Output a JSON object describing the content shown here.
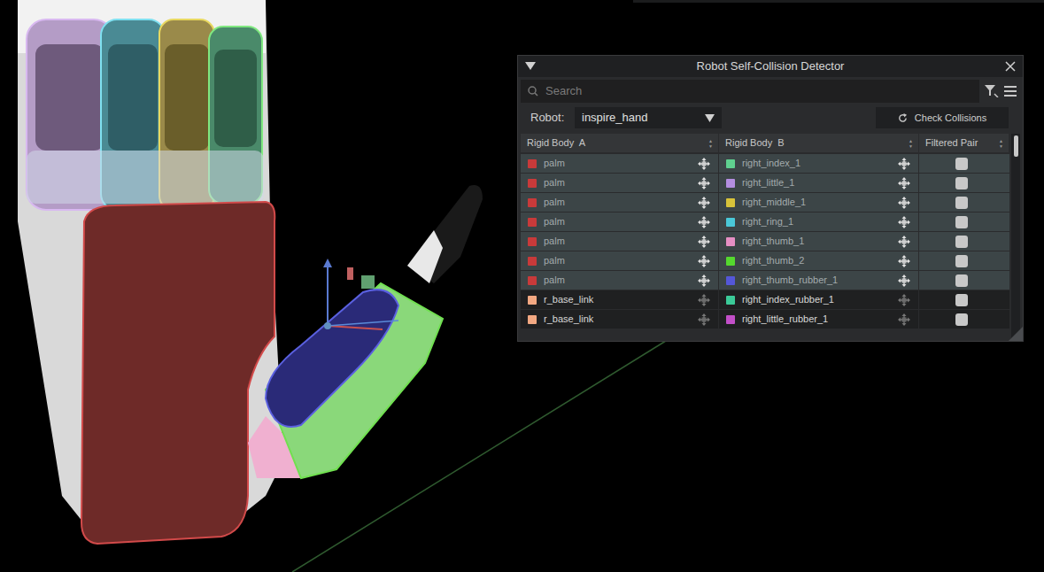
{
  "window": {
    "title": "Robot Self-Collision Detector"
  },
  "search": {
    "placeholder": "Search"
  },
  "robot": {
    "label": "Robot:",
    "value": "inspire_hand"
  },
  "check_button": "Check Collisions",
  "table": {
    "columns": [
      "Rigid Body  A",
      "Rigid Body  B",
      "Filtered Pair"
    ],
    "rows": [
      {
        "a": {
          "name": "palm",
          "color": "#c83a3a"
        },
        "b": {
          "name": "right_index_1",
          "color": "#5fd08f"
        },
        "filtered": false,
        "selected": true
      },
      {
        "a": {
          "name": "palm",
          "color": "#c83a3a"
        },
        "b": {
          "name": "right_little_1",
          "color": "#b48ee0"
        },
        "filtered": false,
        "selected": true
      },
      {
        "a": {
          "name": "palm",
          "color": "#c83a3a"
        },
        "b": {
          "name": "right_middle_1",
          "color": "#d8c33a"
        },
        "filtered": false,
        "selected": true
      },
      {
        "a": {
          "name": "palm",
          "color": "#c83a3a"
        },
        "b": {
          "name": "right_ring_1",
          "color": "#4ac8d8"
        },
        "filtered": false,
        "selected": true
      },
      {
        "a": {
          "name": "palm",
          "color": "#c83a3a"
        },
        "b": {
          "name": "right_thumb_1",
          "color": "#e68fc4"
        },
        "filtered": false,
        "selected": true
      },
      {
        "a": {
          "name": "palm",
          "color": "#c83a3a"
        },
        "b": {
          "name": "right_thumb_2",
          "color": "#55d82e"
        },
        "filtered": false,
        "selected": true
      },
      {
        "a": {
          "name": "palm",
          "color": "#c83a3a"
        },
        "b": {
          "name": "right_thumb_rubber_1",
          "color": "#5457d8"
        },
        "filtered": false,
        "selected": true
      },
      {
        "a": {
          "name": "r_base_link",
          "color": "#f2a882"
        },
        "b": {
          "name": "right_index_rubber_1",
          "color": "#3bca98"
        },
        "filtered": false,
        "selected": false
      },
      {
        "a": {
          "name": "r_base_link",
          "color": "#f2a882"
        },
        "b": {
          "name": "right_little_rubber_1",
          "color": "#c24fc8"
        },
        "filtered": false,
        "selected": false
      }
    ]
  }
}
